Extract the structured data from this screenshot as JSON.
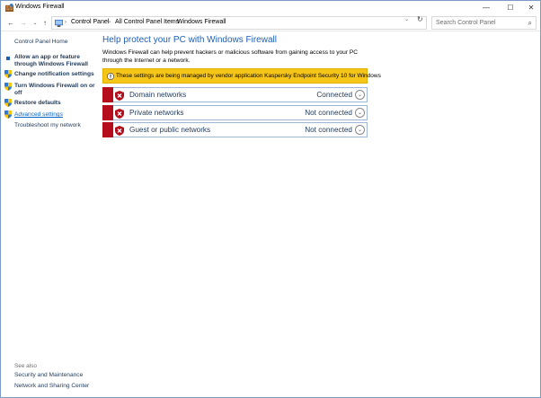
{
  "window": {
    "title": "Windows Firewall",
    "minimize_glyph": "—",
    "maximize_glyph": "☐",
    "close_glyph": "✕"
  },
  "address": {
    "back_glyph": "←",
    "forward_glyph": "→",
    "dropdown_glyph": "⌄",
    "up_glyph": "↑",
    "sep_glyph": "›",
    "crumbs": [
      "Control Panel",
      "All Control Panel Items",
      "Windows Firewall"
    ],
    "refresh_glyph": "↻",
    "search_placeholder": "Search Control Panel",
    "search_glyph": "⌕"
  },
  "sidebar": {
    "home": "Control Panel Home",
    "tasks": [
      {
        "label": "Allow an app or feature through Windows Firewall",
        "icon": "bullet-icon"
      },
      {
        "label": "Change notification settings",
        "icon": "shield-icon"
      },
      {
        "label": "Turn Windows Firewall on or off",
        "icon": "shield-icon"
      },
      {
        "label": "Restore defaults",
        "icon": "shield-icon"
      },
      {
        "label": "Advanced settings",
        "icon": "shield-icon"
      },
      {
        "label": "Troubleshoot my network",
        "icon": ""
      }
    ],
    "see_also": "See also",
    "see_also_links": [
      "Security and Maintenance",
      "Network and Sharing Center"
    ]
  },
  "main": {
    "heading": "Help protect your PC with Windows Firewall",
    "description": "Windows Firewall can help prevent hackers or malicious software from gaining access to your PC through the Internet or a network.",
    "warning": "These settings are being managed by vendor application Kaspersky Endpoint Security 10 for Windows",
    "expand_glyph": "⌄",
    "networks": [
      {
        "name": "Domain networks",
        "status": "Connected"
      },
      {
        "name": "Private networks",
        "status": "Not connected"
      },
      {
        "name": "Guest or public networks",
        "status": "Not connected"
      }
    ]
  },
  "colors": {
    "accent_bar": "#b50d1b",
    "link": "#1e395b",
    "heading": "#1e5fb4",
    "warning_bg": "#f5c518"
  }
}
